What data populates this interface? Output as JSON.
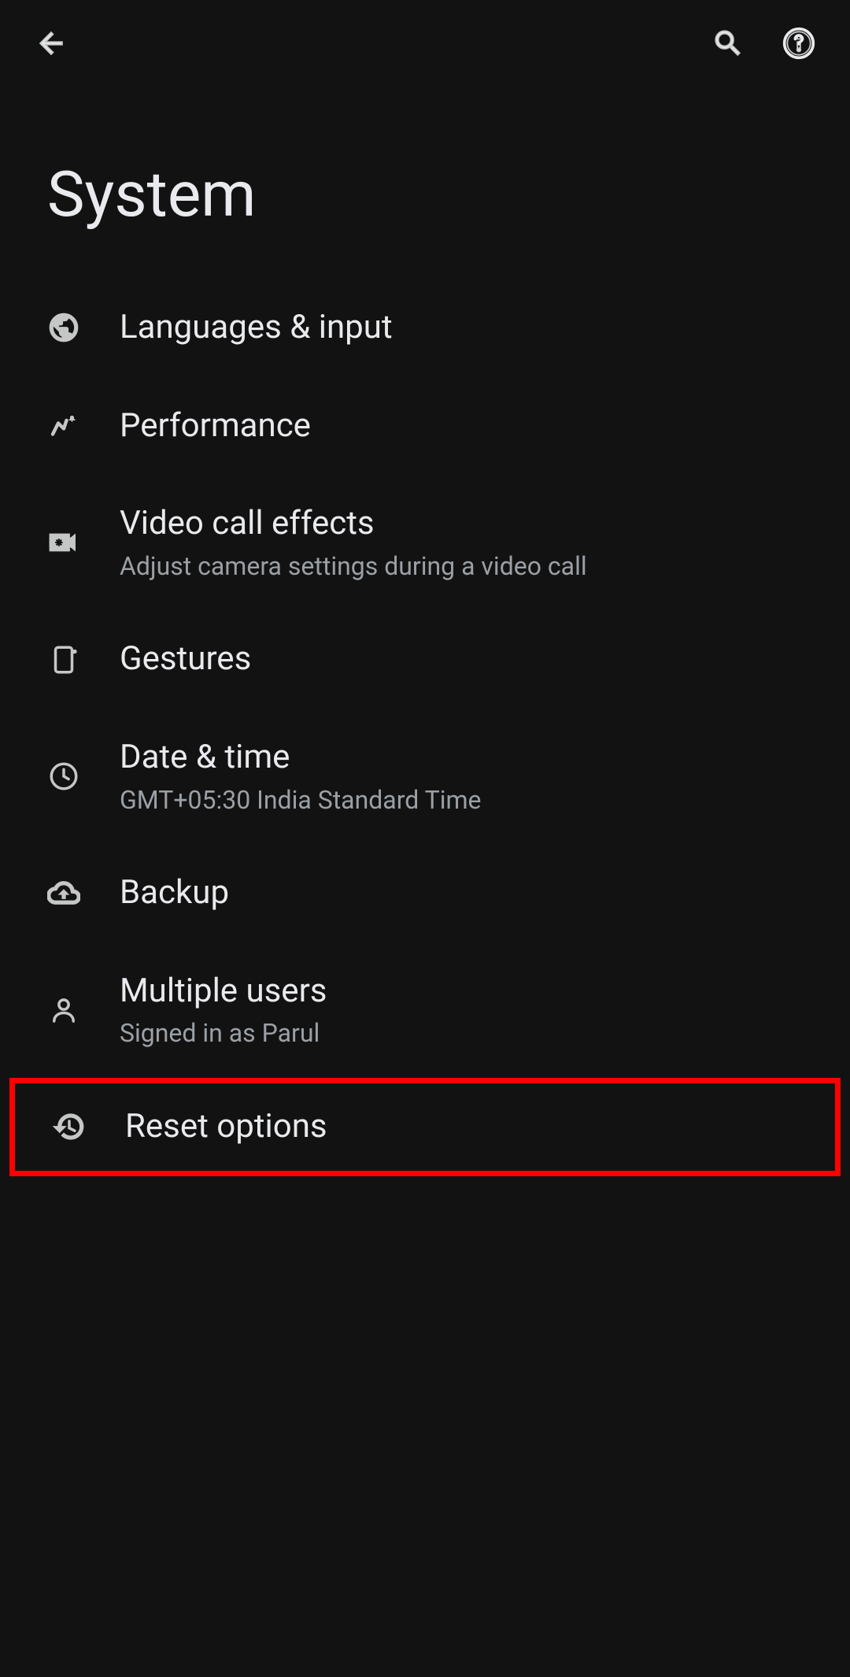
{
  "page": {
    "title": "System"
  },
  "items": [
    {
      "title": "Languages & input",
      "subtitle": null
    },
    {
      "title": "Performance",
      "subtitle": null
    },
    {
      "title": "Video call effects",
      "subtitle": "Adjust camera settings during a video call"
    },
    {
      "title": "Gestures",
      "subtitle": null
    },
    {
      "title": "Date & time",
      "subtitle": "GMT+05:30 India Standard Time"
    },
    {
      "title": "Backup",
      "subtitle": null
    },
    {
      "title": "Multiple users",
      "subtitle": "Signed in as Parul"
    },
    {
      "title": "Reset options",
      "subtitle": null
    }
  ]
}
